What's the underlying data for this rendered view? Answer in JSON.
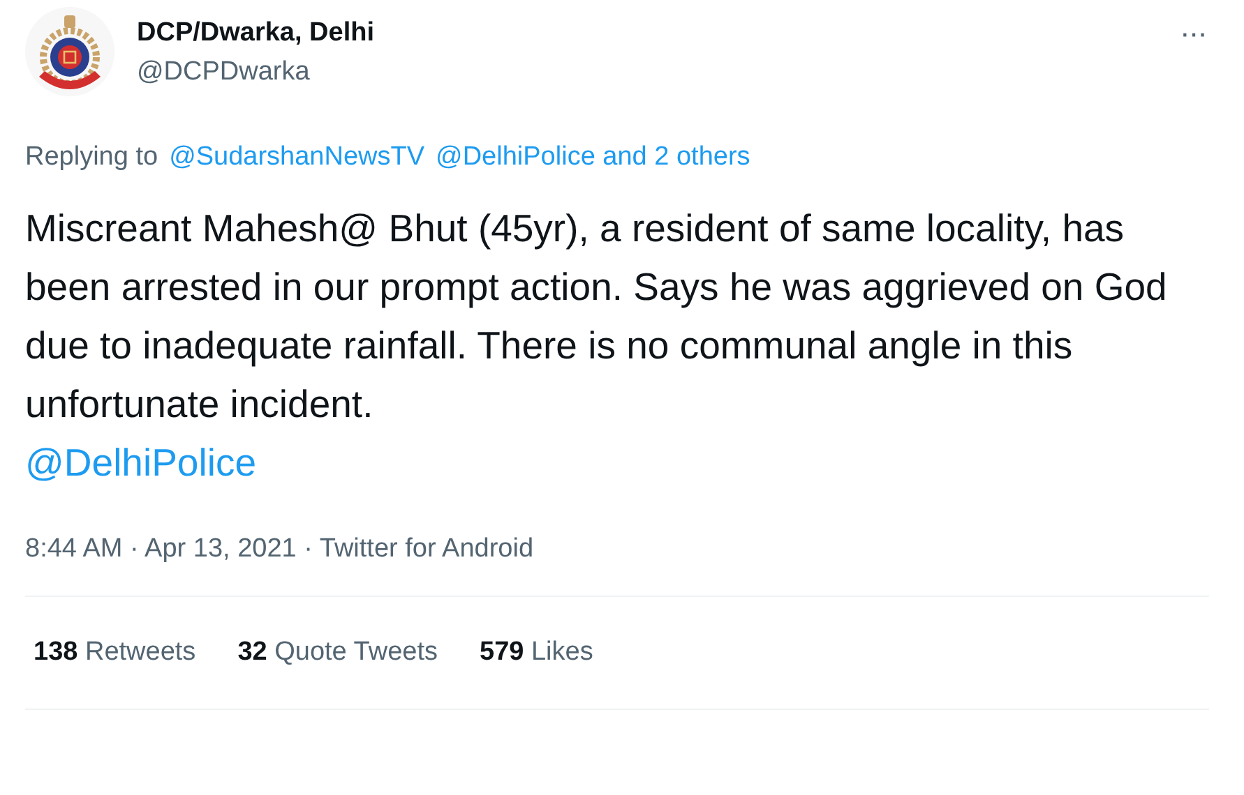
{
  "author": {
    "name": "DCP/Dwarka, Delhi",
    "handle": "@DCPDwarka"
  },
  "more": "···",
  "reply": {
    "prefix": "Replying to",
    "mentions": [
      "@SudarshanNewsTV",
      "@DelhiPolice and 2 others"
    ]
  },
  "tweet": {
    "text": "Miscreant Mahesh@ Bhut (45yr), a resident of same locality, has been arrested in our prompt action. Says he was aggrieved on God due to inadequate rainfall. There is no communal angle in this unfortunate incident.",
    "mention": "@DelhiPolice"
  },
  "timestamp": "8:44 AM · Apr 13, 2021 · Twitter for Android",
  "stats": [
    {
      "count": "138",
      "label": "Retweets"
    },
    {
      "count": "32",
      "label": "Quote Tweets"
    },
    {
      "count": "579",
      "label": "Likes"
    }
  ]
}
